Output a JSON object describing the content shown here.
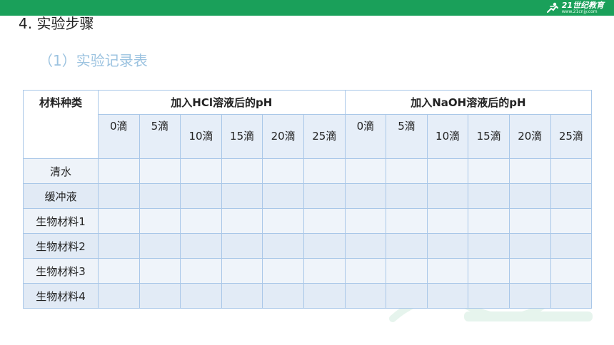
{
  "header": {
    "logo_text": "21世纪教育",
    "logo_url": "www.21cnjy.com"
  },
  "title": "4. 实验步骤",
  "subtitle": "（1）实验记录表",
  "table": {
    "corner": "材料种类",
    "groups": [
      "加入HCl溶液后的pH",
      "加入NaOH溶液后的pH"
    ],
    "drops": [
      "0滴",
      "5滴",
      "10滴",
      "15滴",
      "20滴",
      "25滴"
    ],
    "rows": [
      "清水",
      "缓冲液",
      "生物材料1",
      "生物材料2",
      "生物材料3",
      "生物材料4"
    ]
  },
  "colors": {
    "brand_green": "#1aa05a",
    "subtitle": "#9cc3e0",
    "table_border": "#a9c7e8"
  }
}
